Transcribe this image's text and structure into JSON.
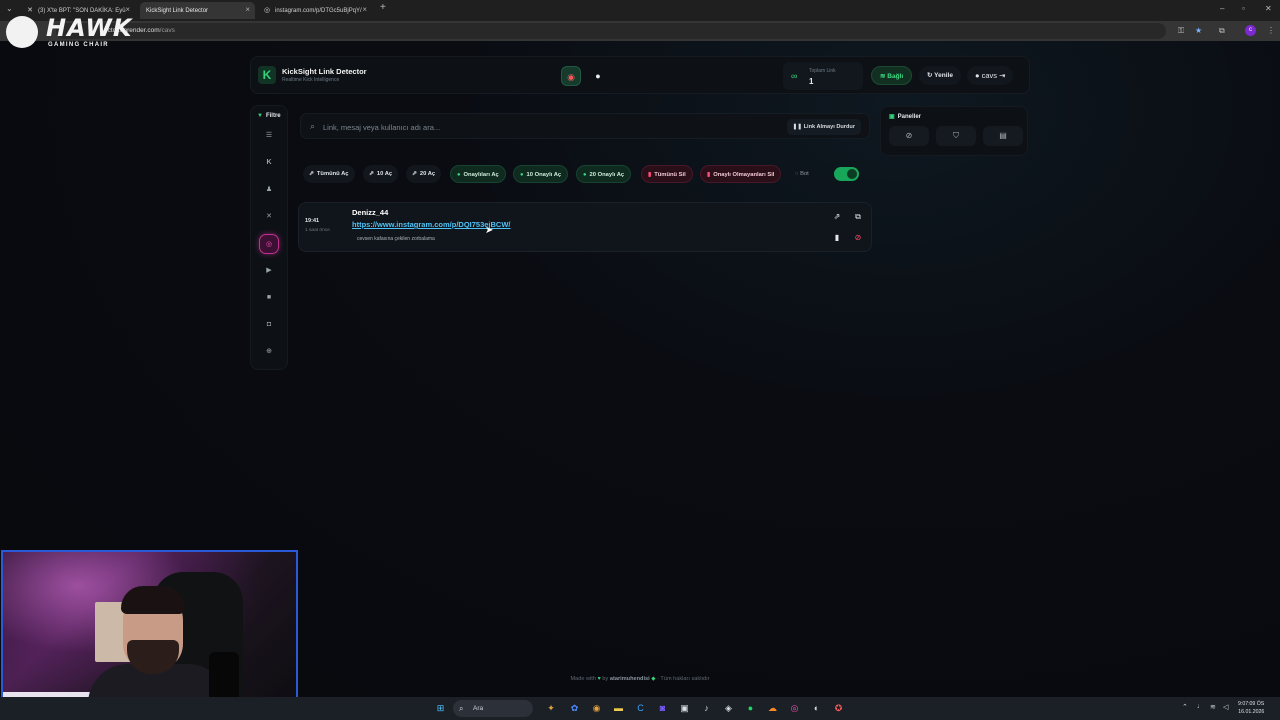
{
  "browser": {
    "tabs": [
      {
        "label": "(3) X'te BPT: \"SON DAKİKA: Eyü",
        "icon": "x-logo-icon"
      },
      {
        "label": "KickSight Link Detector",
        "icon": "kicksight-icon"
      },
      {
        "label": "instagram.com/p/DTGc5uBjPqY/",
        "icon": "instagram-icon"
      }
    ],
    "url_host": "ector.onrender.com",
    "url_path": "/cavs"
  },
  "watermark": {
    "title": "HAWK",
    "subtitle": "GAMING CHAIR"
  },
  "header": {
    "brand_title": "KickSight Link Detector",
    "brand_subtitle": "Realtime Kick Intelligence",
    "stat_label": "Toplam Link",
    "stat_value": "1",
    "connected_label": "Bağlı",
    "refresh_label": "Yenile",
    "user_label": "cavs"
  },
  "filters": {
    "title": "Filtre",
    "items": [
      {
        "name": "all",
        "icon": "list-icon"
      },
      {
        "name": "kick",
        "icon": "kick-icon"
      },
      {
        "name": "users",
        "icon": "user-icon"
      },
      {
        "name": "x",
        "icon": "x-logo-icon"
      },
      {
        "name": "instagram",
        "icon": "instagram-icon",
        "active": true
      },
      {
        "name": "youtube",
        "icon": "youtube-icon"
      },
      {
        "name": "video",
        "icon": "video-icon"
      },
      {
        "name": "camera",
        "icon": "camera-icon"
      },
      {
        "name": "web",
        "icon": "globe-icon"
      }
    ]
  },
  "search": {
    "placeholder": "Link, mesaj veya kullanıcı adı ara...",
    "stop_label": "Link Almayı Durdur"
  },
  "actions": {
    "open_all": "Tümünü Aç",
    "open_10": "10 Aç",
    "open_20": "20 Aç",
    "open_approved": "Onaylıları Aç",
    "open_10_approved": "10 Onaylı Aç",
    "open_20_approved": "20 Onaylı Aç",
    "delete_all": "Tümünü Sil",
    "delete_unapproved": "Onaylı Olmayanları Sil",
    "bot_label": "Bot",
    "bot_enabled": true
  },
  "links": [
    {
      "time": "19:41",
      "ago": "1 saat önce",
      "user": "Denizz_44",
      "url": "https://www.instagram.com/p/DQI753ejBCW/",
      "message": "cevsen kafasına çekilen zorbalama"
    }
  ],
  "panels": {
    "title": "Paneller",
    "items": [
      {
        "icon": "ban-icon"
      },
      {
        "icon": "shield-icon"
      },
      {
        "icon": "archive-icon"
      }
    ]
  },
  "footer": {
    "made_with": "Made with",
    "by": "by",
    "author": "atarimuhendisi",
    "rights": "· Tüm hakları saklıdır"
  },
  "taskbar": {
    "search_label": "Ara",
    "time": "9:07:09 ÖS",
    "date": "16.01.2026"
  },
  "colors": {
    "accent_green": "#34d27a",
    "instagram_pink": "#ff4fb7",
    "link_blue": "#4fc3f7",
    "danger": "#ff4d6d"
  }
}
